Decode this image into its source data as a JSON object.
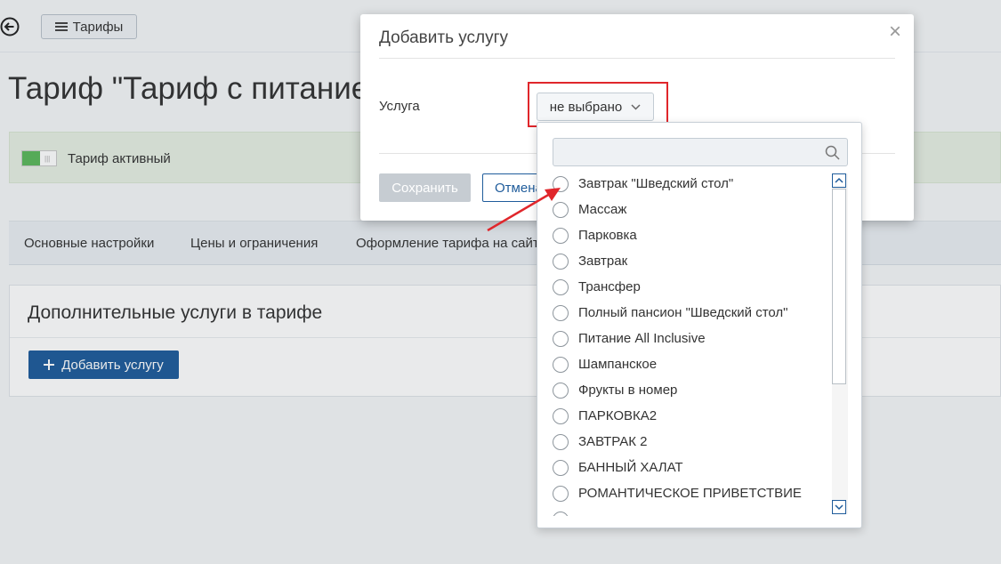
{
  "header": {
    "back_icon": "arrow-left-circle-icon",
    "tariffs_label": "Тарифы",
    "menu_icon": "hamburger-icon"
  },
  "page": {
    "title": "Тариф \"Тариф с питанием"
  },
  "status": {
    "label": "Тариф активный",
    "active": true
  },
  "tabs": [
    {
      "label": "Основные настройки"
    },
    {
      "label": "Цены и ограничения"
    },
    {
      "label": "Оформление тарифа на сайт"
    }
  ],
  "services": {
    "title": "Дополнительные услуги в тарифе",
    "add_label": "Добавить услугу"
  },
  "modal": {
    "title": "Добавить услугу",
    "close_glyph": "×",
    "field_label": "Услуга",
    "select_value": "не выбрано",
    "save_label": "Сохранить",
    "cancel_label": "Отмена"
  },
  "dropdown": {
    "search_value": "",
    "options": [
      "Завтрак \"Шведский стол\"",
      "Массаж",
      "Парковка",
      "Завтрак",
      "Трансфер",
      "Полный пансион \"Шведский стол\"",
      "Питание All Inclusive",
      "Шампанское",
      "Фрукты в номер",
      "ПАРКОВКА2",
      "ЗАВТРАК 2",
      "БАННЫЙ ХАЛАТ",
      "РОМАНТИЧЕСКОЕ ПРИВЕТСТВИЕ"
    ]
  },
  "colors": {
    "primary": "#1f5c9b",
    "highlight": "#e0262b",
    "active_green": "#5cb85c"
  }
}
